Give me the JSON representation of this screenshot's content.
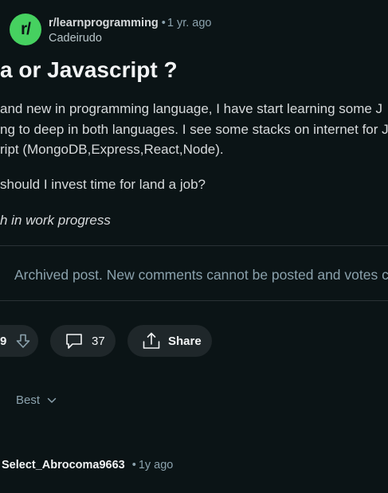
{
  "post": {
    "avatar_text": "r/",
    "subreddit": "r/learnprogramming",
    "separator": "•",
    "time": "1 yr. ago",
    "author": "Cadeirudo",
    "title": "a or Javascript ?",
    "body_lines": [
      "and new in programming language, I have start learning some J",
      "ng to deep in both languages. I see some stacks on internet for J",
      "ript (MongoDB,Express,React,Node)."
    ],
    "question": "should I invest time for land a job?",
    "italic_note": "h in work progress",
    "archived_notice": "Archived post. New comments cannot be posted and votes c"
  },
  "actions": {
    "vote_score": "9",
    "comment_count": "37",
    "share_label": "Share"
  },
  "sort": {
    "prefix": ":",
    "label": "Best"
  },
  "comment": {
    "username": "Select_Abrocoma9663",
    "separator": "•",
    "time": "1y ago"
  },
  "colors": {
    "background": "#0b1416",
    "pill": "#1f272a",
    "avatar": "#46d160",
    "muted": "#8ba2ad"
  }
}
